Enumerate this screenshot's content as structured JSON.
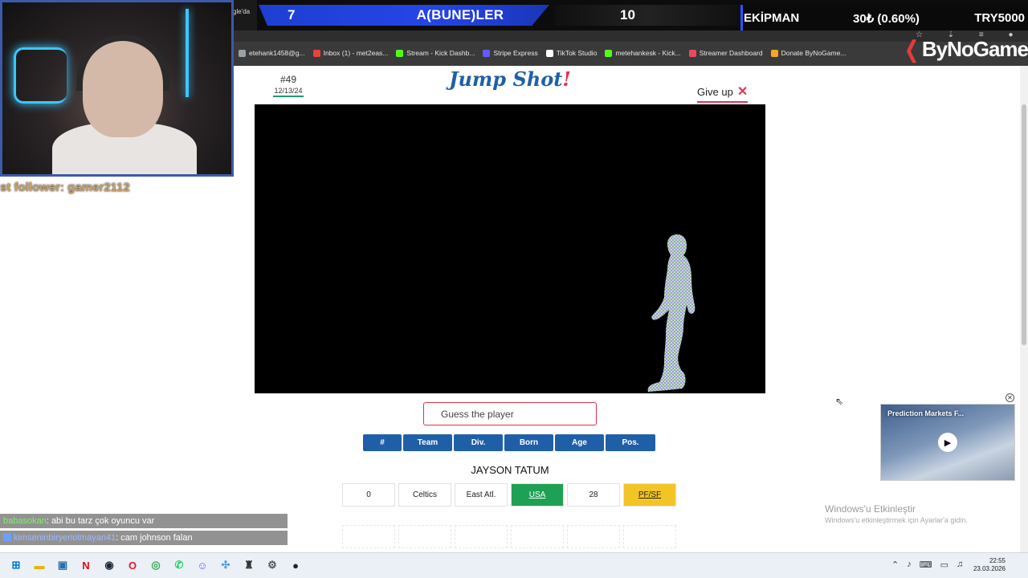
{
  "overlay": {
    "side_text": "gle'da",
    "score_left": "7",
    "score_title": "A(BUNE)LER",
    "score_right": "10",
    "team_name": "EKİPMAN",
    "team_value": "30₺ (0.60%)",
    "team_currency": "TRY5000"
  },
  "webcam": {
    "follower_text": "st follower: gamer2112"
  },
  "bookmarks": [
    {
      "label": "etehank1458@g...",
      "icon": "mail-icon",
      "color": "#9aa0a6"
    },
    {
      "label": "Inbox (1) - met2eas...",
      "icon": "gmail-icon",
      "color": "#ea4335"
    },
    {
      "label": "Stream - Kick Dashb...",
      "icon": "kick-icon",
      "color": "#53fc18"
    },
    {
      "label": "Stripe Express",
      "icon": "stripe-icon",
      "color": "#635bff"
    },
    {
      "label": "TikTok Studio",
      "icon": "tiktok-icon",
      "color": "#ffffff"
    },
    {
      "label": "metehankesk - Kick...",
      "icon": "kick-icon",
      "color": "#53fc18"
    },
    {
      "label": "Streamer Dashboard",
      "icon": "dashboard-icon",
      "color": "#e84a5f"
    },
    {
      "label": "Donate ByNoGame...",
      "icon": "donate-icon",
      "color": "#f5a623"
    }
  ],
  "brand": {
    "logo_text": "ByNoGame"
  },
  "game": {
    "puzzle_number": "#49",
    "puzzle_date": "12/13/24",
    "title_main": "Jump Shot",
    "title_bang": "!",
    "give_up_label": "Give up",
    "input_placeholder": "Guess the player",
    "columns": [
      "#",
      "Team",
      "Div.",
      "Born",
      "Age",
      "Pos."
    ],
    "guess_name": "JAYSON TATUM",
    "guess_cells": [
      {
        "value": "0",
        "status": "none"
      },
      {
        "value": "Celtics",
        "status": "none"
      },
      {
        "value": "East Atl.",
        "status": "none"
      },
      {
        "value": "USA",
        "status": "correct"
      },
      {
        "value": "28",
        "status": "none"
      },
      {
        "value": "PF/SF",
        "status": "partial"
      }
    ],
    "colors": {
      "correct": "#1fa155",
      "partial": "#f2c524",
      "header": "#1f5fa8",
      "accent": "#e0335a"
    }
  },
  "ad": {
    "title": "Prediction Markets F..."
  },
  "windows": {
    "activate_title": "Windows'u Etkinleştir",
    "activate_sub": "Windows'u etkinleştirmek için Ayarlar'a gidin."
  },
  "chat": [
    {
      "user": "babasokan",
      "message": ": abi bu tarz çok oyuncu var"
    },
    {
      "user": "kimseninbiryeriolmayan41",
      "message": ": cam johnson falan"
    }
  ],
  "taskbar": {
    "clock_time": "22:55",
    "clock_date": "23.03.2026"
  }
}
